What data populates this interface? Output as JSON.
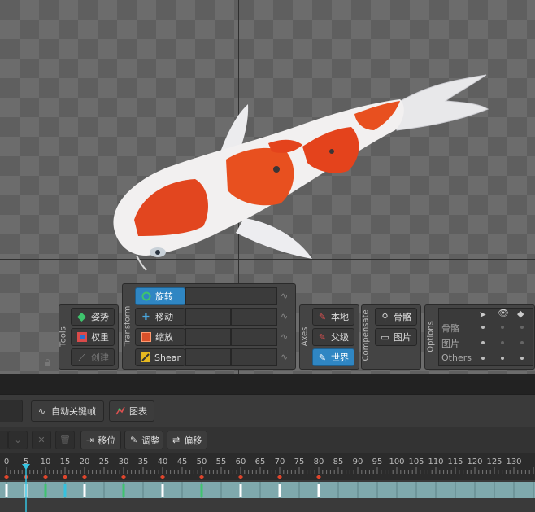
{
  "tools": {
    "label": "Tools",
    "items": [
      {
        "label": "姿势",
        "icon": "pose-icon",
        "color": "#3ec46d",
        "state": "normal"
      },
      {
        "label": "权重",
        "icon": "weights-icon",
        "color": "#e05050",
        "state": "normal"
      },
      {
        "label": "创建",
        "icon": "create-icon",
        "color": "#888888",
        "state": "disabled"
      }
    ]
  },
  "transform": {
    "label": "Transform",
    "items": [
      {
        "label": "旋转",
        "icon": "rotate-icon",
        "state": "active"
      },
      {
        "label": "移动",
        "icon": "translate-icon",
        "state": "normal"
      },
      {
        "label": "缩放",
        "icon": "scale-icon",
        "state": "normal"
      },
      {
        "label": "Shear",
        "icon": "shear-icon",
        "state": "normal"
      }
    ]
  },
  "axes": {
    "label": "Axes",
    "items": [
      {
        "label": "本地",
        "state": "normal"
      },
      {
        "label": "父级",
        "state": "normal"
      },
      {
        "label": "世界",
        "state": "active"
      }
    ]
  },
  "compensate": {
    "label": "Compensate",
    "items": [
      {
        "label": "骨骼",
        "icon": "bone-icon"
      },
      {
        "label": "图片",
        "icon": "image-icon"
      }
    ]
  },
  "options": {
    "label": "Options",
    "columns": [
      "cursor-icon",
      "eye-icon",
      "tag-icon"
    ],
    "rows": [
      {
        "label": "骨骼",
        "values": [
          true,
          false,
          false
        ]
      },
      {
        "label": "图片",
        "values": [
          true,
          false,
          false
        ]
      },
      {
        "label": "Others",
        "values": [
          true,
          true,
          true
        ]
      }
    ]
  },
  "timeline": {
    "auto_key_label": "自动关键帧",
    "graph_label": "图表",
    "offset_label": "移位",
    "adjust_label": "调整",
    "shift_label": "偏移",
    "ticks": [
      "0",
      "5",
      "10",
      "15",
      "20",
      "25",
      "30",
      "35",
      "40",
      "45",
      "50",
      "55",
      "60",
      "65",
      "70",
      "75",
      "80",
      "85",
      "90",
      "95",
      "100",
      "105",
      "110",
      "115",
      "120",
      "125",
      "130"
    ],
    "current_frame": 5,
    "keyframes": [
      0,
      5,
      10,
      15,
      20,
      30,
      40,
      50,
      60,
      70,
      80
    ]
  },
  "colors": {
    "accent": "#2f86c3",
    "keyframe_red": "#e0452c",
    "playhead": "#35c3e0",
    "track": "#7fa9ad"
  }
}
